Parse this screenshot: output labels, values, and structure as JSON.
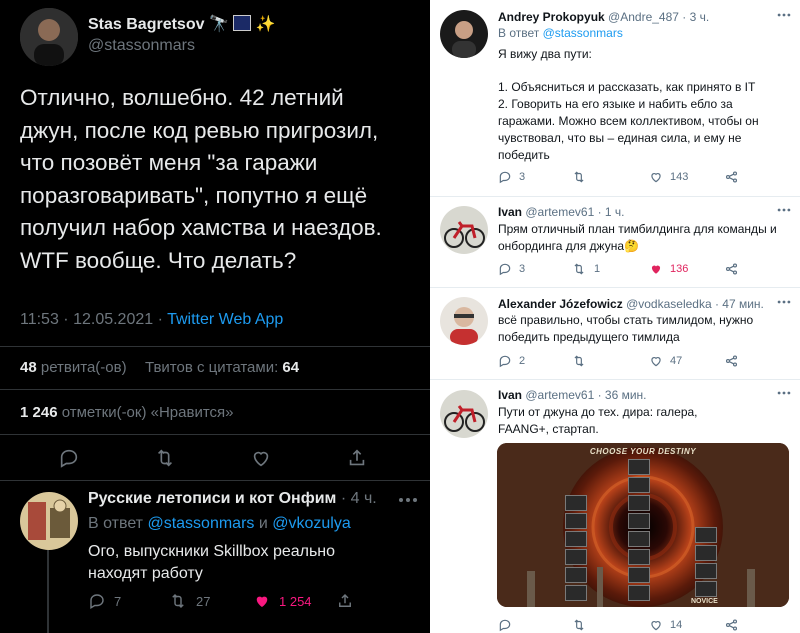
{
  "main_tweet": {
    "author_name": "Stas Bagretsov",
    "author_emoji": "🔭 🌌 ✨",
    "handle": "@stassonmars",
    "text": "Отлично, волшебно. 42 летний джун, после код ревью пригрозил, что позовёт меня \"за гаражи поразговаривать\", попутно я ещё получил набор хамства и наездов. WTF вообще. Что делать?",
    "time": "11:53 · 12.05.2021 ·",
    "client": "Twitter Web App",
    "retweets_count": "48",
    "retweets_label": "ретвита(-ов)",
    "quotes_label": "Твитов с цитатами:",
    "quotes_count": "64",
    "likes_count": "1 246",
    "likes_label": "отметки(-ок) «Нравится»"
  },
  "left_reply": {
    "author_name": "Русские летописи и кот Онфим",
    "time": "· 4 ч.",
    "reply_prefix": "В ответ",
    "reply_to_1": "@stassonmars",
    "reply_and": "и",
    "reply_to_2": "@vkozulya",
    "text": "Ого, выпускники Skillbox реально находят работу",
    "replies": "7",
    "retweets": "27",
    "likes": "1 254"
  },
  "right_replies": [
    {
      "name": "Andrey Prokopyuk",
      "meta": "@Andre_487 · 3 ч.",
      "reply_prefix": "В ответ",
      "reply_to": "@stassonmars",
      "line1": "Я вижу два пути:",
      "line2": "1. Объясниться и рассказать, как принято в IT",
      "line3": "2. Говорить на его языке и набить ебло за гаражами. Можно всем коллективом, чтобы он чувствовал, что вы – единая сила, и ему не победить",
      "replies": "3",
      "retweets": "",
      "likes": "143"
    },
    {
      "name": "Ivan",
      "meta": "@artemev61 · 1 ч.",
      "text": "Прям отличный план тимбилдинга для команды и онбординга для джуна🤔",
      "replies": "3",
      "retweets": "1",
      "likes": "136"
    },
    {
      "name": "Alexander Józefowicz",
      "meta": "@vodkaseledka · 47 мин.",
      "text": "всё правильно, чтобы стать тимлидом, нужно победить предыдущего тимлида",
      "replies": "2",
      "retweets": "",
      "likes": "47"
    },
    {
      "name": "Ivan",
      "meta": "@artemev61 · 36 мин.",
      "text": "Пути от джуна до тех. дира: галера, FAANG+, стартап.",
      "image_title": "CHOOSE YOUR DESTINY",
      "image_bottom_label": "NOVICE",
      "replies": "",
      "retweets": "",
      "likes": "14"
    }
  ],
  "colors": {
    "accent_blue": "#1d9bf0",
    "like_red": "#f91880",
    "dark_bg": "#000000",
    "light_bg": "#ffffff"
  },
  "icons": [
    "telescope-icon",
    "galaxy-icon",
    "sparkles-icon",
    "reply-icon",
    "retweet-icon",
    "like-icon",
    "share-icon",
    "more-icon"
  ]
}
